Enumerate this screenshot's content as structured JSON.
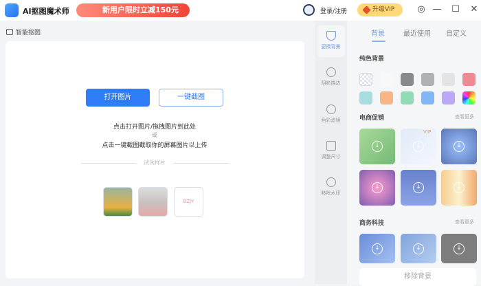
{
  "titlebar": {
    "app_title": "AI抠图魔术师",
    "promo": "新用户限时立减150元",
    "login": "登录/注册",
    "vip": "升级VIP",
    "controls": [
      "settings",
      "minimize",
      "maximize",
      "close"
    ]
  },
  "breadcrumb": "智能抠图",
  "main": {
    "open_button": "打开图片",
    "screenshot_button": "一键截图",
    "hint1": "点击打开图片/拖拽图片到此处",
    "hint_or": "或",
    "hint2": "点击一键截图截取你的屏幕图片以上传",
    "samples_label": "试试样片",
    "samples": [
      "woman-photo",
      "gift-box-photo",
      "logo-photo"
    ]
  },
  "sidebar": {
    "items": [
      {
        "label": "更换背景",
        "active": true
      },
      {
        "label": "阴影描边"
      },
      {
        "label": "色彩滤镜"
      },
      {
        "label": "调整尺寸"
      },
      {
        "label": "移除水印"
      }
    ]
  },
  "panel": {
    "tabs": [
      "背景",
      "最近使用",
      "自定义"
    ],
    "solid_title": "纯色背景",
    "swatches": [
      "transparent",
      "#f8f8f8",
      "#666666",
      "#999999",
      "#dddddd",
      "#ee6670",
      "#8ed4d8",
      "#f6a060",
      "#6fd3a0",
      "#5aa2f5",
      "#a78df5",
      "rainbow"
    ],
    "ecommerce_title": "电商促销",
    "ecommerce_more": "查看更多",
    "vip_badge": "VIP",
    "business_title": "商务科技",
    "business_more": "查看更多",
    "remove_button": "移除背景"
  }
}
